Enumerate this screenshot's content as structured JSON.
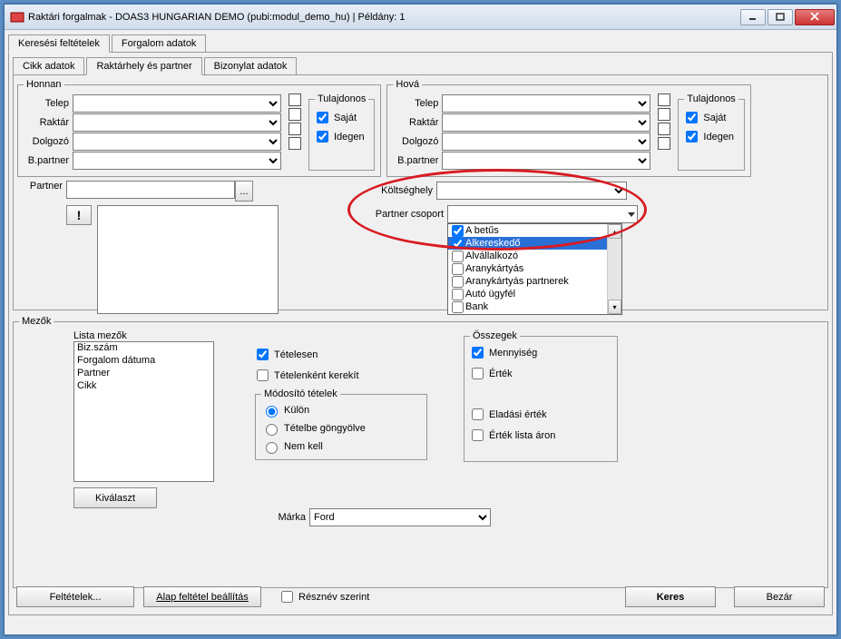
{
  "title": "Raktári forgalmak - DOAS3 HUNGARIAN DEMO (pubi:modul_demo_hu) | Példány: 1",
  "mainTabs": {
    "t1": "Keresési feltételek",
    "t2": "Forgalom adatok"
  },
  "subTabs": {
    "s1": "Cikk adatok",
    "s2": "Raktárhely és partner",
    "s3": "Bizonylat adatok"
  },
  "honnan": {
    "legend": "Honnan",
    "telep": "Telep",
    "raktar": "Raktár",
    "dolgozo": "Dolgozó",
    "bpartner": "B.partner"
  },
  "hova": {
    "legend": "Hová",
    "telep": "Telep",
    "raktar": "Raktár",
    "dolgozo": "Dolgozó",
    "bpartner": "B.partner"
  },
  "tulajdonos": {
    "legend": "Tulajdonos",
    "sajat": "Saját",
    "idegen": "Idegen"
  },
  "partnerLbl": "Partner",
  "koltseghelyLbl": "Költséghely",
  "partnerCsoportLbl": "Partner csoport",
  "partnerCsoportItems": {
    "i0": "A betűs",
    "i1": "Alkereskedő",
    "i2": "Alvállalkozó",
    "i3": "Aranykártyás",
    "i4": "Aranykártyás partnerek",
    "i5": "Autó ügyfél",
    "i6": "Bank"
  },
  "mezok": {
    "legend": "Mezők",
    "lista": "Lista mezők",
    "items": {
      "m0": "Biz.szám",
      "m1": "Forgalom dátuma",
      "m2": "Partner",
      "m3": "Cikk"
    },
    "kivalaszt": "Kiválaszt"
  },
  "options": {
    "tetelesen": "Tételesen",
    "tetelenkentKerekit": "Tételenként kerekít",
    "modositoTetelek": "Módosító tételek",
    "kulon": "Külön",
    "tetelbeGongyolve": "Tételbe göngyölve",
    "nemKell": "Nem kell"
  },
  "osszegek": {
    "legend": "Összegek",
    "mennyiseg": "Mennyiség",
    "ertek": "Érték",
    "eladasiErtek": "Eladási érték",
    "ertekListaAron": "Érték lista áron"
  },
  "markaLbl": "Márka",
  "markaValue": "Ford",
  "bottom": {
    "feltetelek": "Feltételek...",
    "alap": "Alap feltétel beállítás",
    "resznev": "Résznév szerint",
    "keres": "Keres",
    "bezar": "Bezár"
  }
}
